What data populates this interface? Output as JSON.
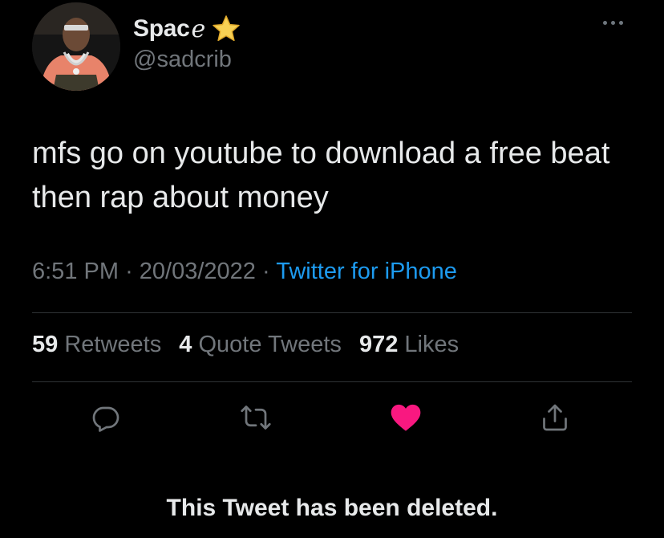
{
  "user": {
    "display_name": "Spac",
    "name_glyph": "e",
    "handle": "@sadcrib",
    "badge_icon": "star-emoji-icon",
    "avatar_icon": "avatar-photo"
  },
  "tweet": {
    "text": "mfs go on youtube to download a free beat then rap about money",
    "time": "6:51 PM",
    "separator": "·",
    "date": "20/03/2022",
    "source": "Twitter for iPhone"
  },
  "stats": {
    "retweets_count": "59",
    "retweets_label": "Retweets",
    "quotes_count": "4",
    "quotes_label": "Quote Tweets",
    "likes_count": "972",
    "likes_label": "Likes"
  },
  "actions": {
    "reply_icon": "reply-icon",
    "retweet_icon": "retweet-icon",
    "like_icon": "heart-icon",
    "share_icon": "share-icon",
    "liked": true
  },
  "notice": {
    "text": "This Tweet has been deleted."
  },
  "colors": {
    "background": "#000000",
    "primary_text": "#e7e9ea",
    "secondary_text": "#71767b",
    "link": "#1d9bf0",
    "like": "#f91880",
    "divider": "#2f3336"
  }
}
